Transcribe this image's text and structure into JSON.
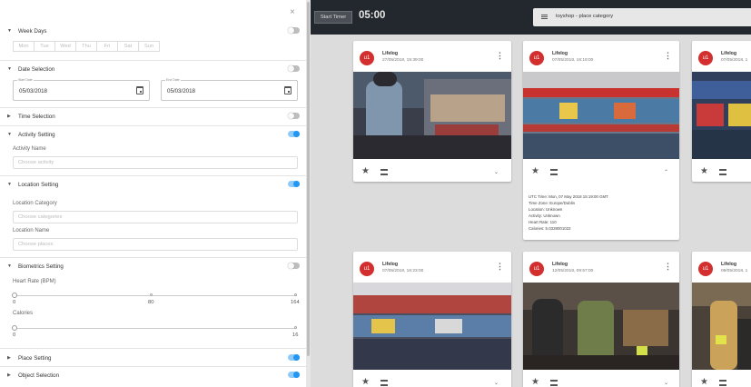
{
  "left_panel": {
    "close_glyph": "×",
    "sections": {
      "week_days": {
        "label": "Week Days",
        "enabled": false
      },
      "date_selection": {
        "label": "Date Selection",
        "enabled": false
      },
      "time_selection": {
        "label": "Time Selection",
        "enabled": false
      },
      "activity_setting": {
        "label": "Activity Setting",
        "enabled": true
      },
      "location_setting": {
        "label": "Location Setting",
        "enabled": true
      },
      "biometrics_setting": {
        "label": "Biometrics Setting",
        "enabled": false
      },
      "place_setting": {
        "label": "Place Setting",
        "enabled": true
      },
      "object_selection": {
        "label": "Object Selection",
        "enabled": true
      }
    },
    "week_days": [
      "Mon",
      "Tue",
      "Wed",
      "Thu",
      "Fri",
      "Sat",
      "Sun"
    ],
    "start_date": {
      "label": "Start Date",
      "value": "05/03/2018"
    },
    "end_date": {
      "label": "End Date",
      "value": "05/03/2018"
    },
    "activity_name": {
      "label": "Activity Name",
      "placeholder": "Choose activity"
    },
    "location_category": {
      "label": "Location Category",
      "placeholder": "Choose categories"
    },
    "location_name": {
      "label": "Location Name",
      "placeholder": "Choose places"
    },
    "heart_rate": {
      "label": "Heart Rate (BPM)",
      "min": "0",
      "mid": "80",
      "max": "164"
    },
    "calories": {
      "label": "Calories",
      "min": "0",
      "max": "16"
    }
  },
  "topbar": {
    "start_timer_label": "Start Timer",
    "timer_value": "05:00",
    "search_query": "toyshop - place category"
  },
  "cards": [
    {
      "avatar": "u1",
      "title": "Lifelog",
      "date": "27/05/2018, 15:39:00"
    },
    {
      "avatar": "u1",
      "title": "Lifelog",
      "date": "07/05/2018, 16:19:00",
      "details": [
        "UTC Time: Mon, 07 May 2018 15:19:00 GMT",
        "Time Zone: Europe/Dublin",
        "Location: Unknown",
        "Activity: Unknown",
        "Heart Rate: 110",
        "Calories: 5.0328001022"
      ]
    },
    {
      "avatar": "u1",
      "title": "Lifelog",
      "date": "07/05/2018, 1"
    },
    {
      "avatar": "u1",
      "title": "Lifelog",
      "date": "07/05/2018, 16:23:00"
    },
    {
      "avatar": "u1",
      "title": "Lifelog",
      "date": "12/05/2018, 09:57:00"
    },
    {
      "avatar": "u1",
      "title": "Lifelog",
      "date": "09/05/2018, 1"
    }
  ],
  "icons": {
    "more": "more-vert-icon",
    "star": "star-icon",
    "list": "list-icon",
    "expand": "chevron-down-icon",
    "collapse": "chevron-up-icon",
    "menu": "hamburger-icon",
    "calendar": "calendar-icon"
  },
  "colors": {
    "accent": "#2196f3",
    "avatar": "#d32f2f",
    "topbar": "#23282e"
  }
}
